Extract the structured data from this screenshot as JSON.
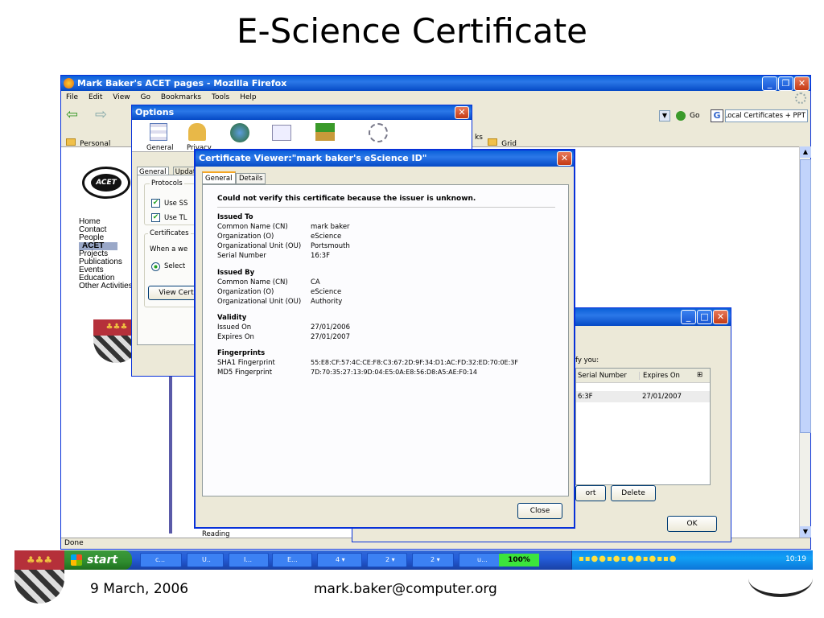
{
  "slide": {
    "title": "E-Science Certificate",
    "footer_date": "9 March, 2006",
    "footer_email": "mark.baker@computer.org"
  },
  "browser": {
    "title": "Mark Baker's ACET pages - Mozilla Firefox",
    "menu": [
      "File",
      "Edit",
      "View",
      "Go",
      "Bookmarks",
      "Tools",
      "Help"
    ],
    "go_label": "Go",
    "search_value": "Local Certificates + PPT",
    "bookmarks": [
      "Personal",
      "Grid"
    ],
    "bookmarks_frag": "ks",
    "status": "Done",
    "sidebar_links": [
      "Home",
      "Contact",
      "People",
      "ACET",
      "Projects",
      "Publications",
      "Events",
      "Education",
      "Other Activities"
    ],
    "bottom_text": "Reading"
  },
  "options": {
    "title": "Options",
    "toolbar": [
      "General",
      "Privacy",
      "Content",
      "Tabs",
      "Downloads",
      "Advanced"
    ],
    "subtabs": [
      "General",
      "Update"
    ],
    "protocols_label": "Protocols",
    "use_ssl": "Use SS",
    "use_tls": "Use TL",
    "certificates_label": "Certificates",
    "when_text": "When a we",
    "select_text": "Select",
    "view_cert": "View Cert"
  },
  "certmanager": {
    "verify_text": "fy you:",
    "columns": [
      "Serial Number",
      "Expires On"
    ],
    "row": [
      "6:3F",
      "27/01/2007"
    ],
    "export_btn": "ort",
    "delete_btn": "Delete",
    "ok_btn": "OK"
  },
  "viewer": {
    "title": "Certificate Viewer:\"mark baker's eScience ID\"",
    "tabs": [
      "General",
      "Details"
    ],
    "warning": "Could not verify this certificate because the issuer is unknown.",
    "issued_to": {
      "heading": "Issued To",
      "rows": [
        [
          "Common Name (CN)",
          "mark baker"
        ],
        [
          "Organization (O)",
          "eScience"
        ],
        [
          "Organizational Unit (OU)",
          "Portsmouth"
        ],
        [
          "Serial Number",
          "16:3F"
        ]
      ]
    },
    "issued_by": {
      "heading": "Issued By",
      "rows": [
        [
          "Common Name (CN)",
          "CA"
        ],
        [
          "Organization (O)",
          "eScience"
        ],
        [
          "Organizational Unit (OU)",
          "Authority"
        ]
      ]
    },
    "validity": {
      "heading": "Validity",
      "rows": [
        [
          "Issued On",
          "27/01/2006"
        ],
        [
          "Expires On",
          "27/01/2007"
        ]
      ]
    },
    "fingerprints": {
      "heading": "Fingerprints",
      "rows": [
        [
          "SHA1 Fingerprint",
          "55:E8:CF:57:4C:CE:F8:C3:67:2D:9F:34:D1:AC:FD:32:ED:70:0E:3F"
        ],
        [
          "MD5 Fingerprint",
          "7D:70:35:27:13:9D:04:E5:0A:E8:56:D8:A5:AE:F0:14"
        ]
      ]
    },
    "close_btn": "Close"
  },
  "taskbar": {
    "start": "start",
    "items": [
      "c...",
      "U..",
      "I...",
      "E...",
      "4",
      "2",
      "2",
      "u..."
    ],
    "zoom": "100%",
    "clock": "10:19"
  },
  "colors": {
    "xp_blue": "#0a5fd8",
    "dialog_bg": "#ece9d8",
    "taskbar_green": "#3c9a3c"
  }
}
